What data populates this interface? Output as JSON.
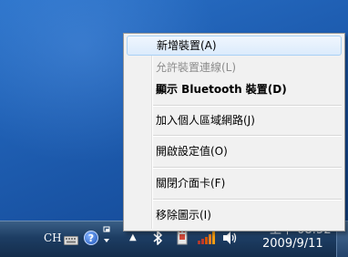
{
  "context_menu": {
    "items": [
      {
        "label": "新增裝置(A)",
        "state": "hover"
      },
      {
        "label": "允許裝置連線(L)",
        "state": "disabled"
      },
      {
        "label": "顯示 Bluetooth 裝置(D)",
        "state": "bold"
      },
      {
        "label": "加入個人區域網路(J)",
        "state": "normal"
      },
      {
        "label": "開啟設定值(O)",
        "state": "normal"
      },
      {
        "label": "關閉介面卡(F)",
        "state": "normal"
      },
      {
        "label": "移除圖示(I)",
        "state": "normal"
      }
    ]
  },
  "taskbar": {
    "language": "CH",
    "help_glyph": "?",
    "show_hidden_glyph": "▲",
    "time": "上午 08:52",
    "date": "2009/9/11",
    "icons": [
      "keyboard-icon",
      "help-icon",
      "language-bar-options-icon",
      "show-hidden-icons-icon",
      "bluetooth-icon",
      "device-icon",
      "network-icon",
      "volume-icon"
    ]
  },
  "colors": {
    "desktop": "#1f5fb3",
    "menu_background": "#f1f1f1",
    "menu_hover_border": "#a8d0f5",
    "taskbar": "#1d3d63"
  }
}
